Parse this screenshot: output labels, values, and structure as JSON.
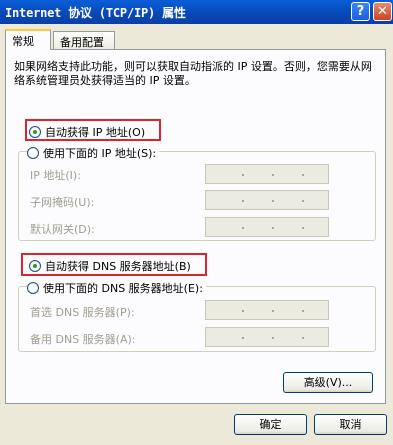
{
  "window": {
    "title": "Internet 协议 (TCP/IP) 属性",
    "help_label": "?",
    "close_label": "✕"
  },
  "tabs": [
    {
      "label": "常规",
      "active": true
    },
    {
      "label": "备用配置",
      "active": false
    }
  ],
  "description": "如果网络支持此功能，则可以获取自动指派的 IP 设置。否则，您需要从网络系统管理员处获得适当的 IP 设置。",
  "ip_section": {
    "auto_label": "自动获得 IP 地址(O)",
    "manual_label": "使用下面的 IP 地址(S):",
    "selected": "auto",
    "fields": [
      {
        "label": "IP 地址(I):"
      },
      {
        "label": "子网掩码(U):"
      },
      {
        "label": "默认网关(D):"
      }
    ]
  },
  "dns_section": {
    "auto_label": "自动获得 DNS 服务器地址(B)",
    "manual_label": "使用下面的 DNS 服务器地址(E):",
    "selected": "auto",
    "fields": [
      {
        "label": "首选 DNS 服务器(P):"
      },
      {
        "label": "备用 DNS 服务器(A):"
      }
    ]
  },
  "buttons": {
    "advanced": "高级(V)...",
    "ok": "确定",
    "cancel": "取消"
  }
}
